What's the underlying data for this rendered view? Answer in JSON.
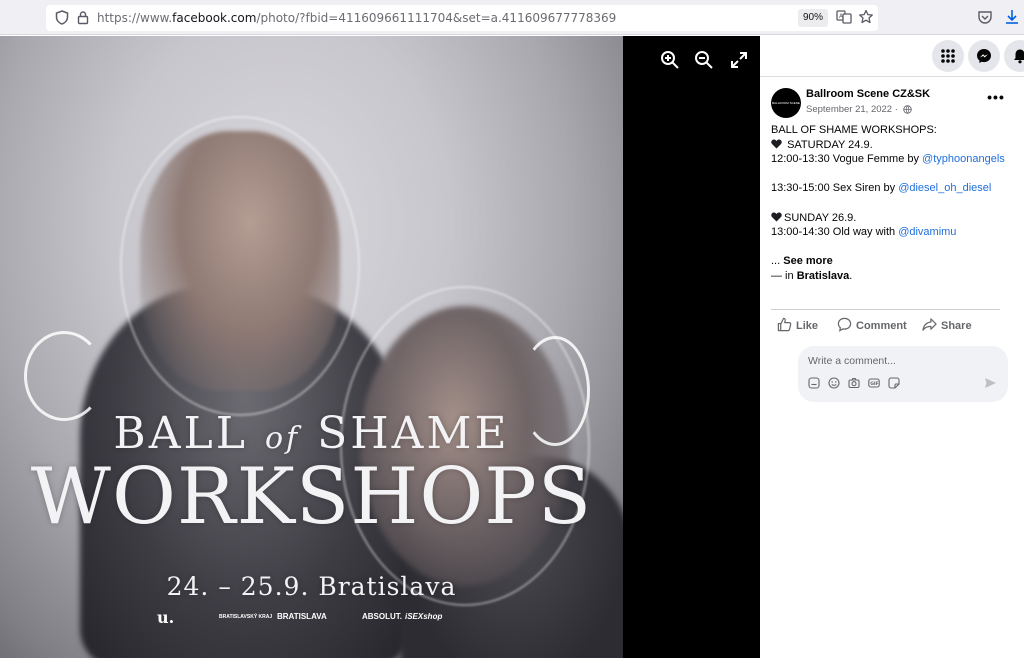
{
  "browser": {
    "url_prefix": "https://www.",
    "url_domain": "facebook.com",
    "url_path": "/photo/?fbid=411609661111704&set=a.411609677778369",
    "zoom": "90%"
  },
  "poster": {
    "line1_a": "BALL",
    "line1_of": "of",
    "line1_b": "SHAME",
    "line2": "WORKSHOPS",
    "line3": "24. – 25.9. Bratislava",
    "logos": [
      "u.",
      "BRATISLAVSKÝ KRAJ",
      "BRATISLAVA",
      "ABSOLUT.",
      "iSEXshop"
    ]
  },
  "post": {
    "author": "Ballroom Scene CZ&SK",
    "avatar_text": "BALLROOM SCENE CZSK",
    "date": "September 21, 2022 ·",
    "lines": {
      "l1": "BALL OF SHAME WORKSHOPS:",
      "l2": "SATURDAY 24.9.",
      "l3_text": "12:00-13:30 Vogue Femme by ",
      "l3_mention": "@typhoonangels",
      "l4_text": "13:30-15:00 Sex Siren by ",
      "l4_mention": "@diesel_oh_diesel",
      "l5": "SUNDAY 26.9.",
      "l6_text": "13:00-14:30 Old way with ",
      "l6_mention": "@divamimu",
      "see_more_prefix": "... ",
      "see_more": "See more",
      "location_prefix": "— in ",
      "location": "Bratislava",
      "location_suffix": "."
    },
    "actions": {
      "like": "Like",
      "comment": "Comment",
      "share": "Share"
    },
    "comment_placeholder": "Write a comment..."
  },
  "colors": {
    "mention": "#216fdb",
    "heart": "#1c1e21"
  }
}
